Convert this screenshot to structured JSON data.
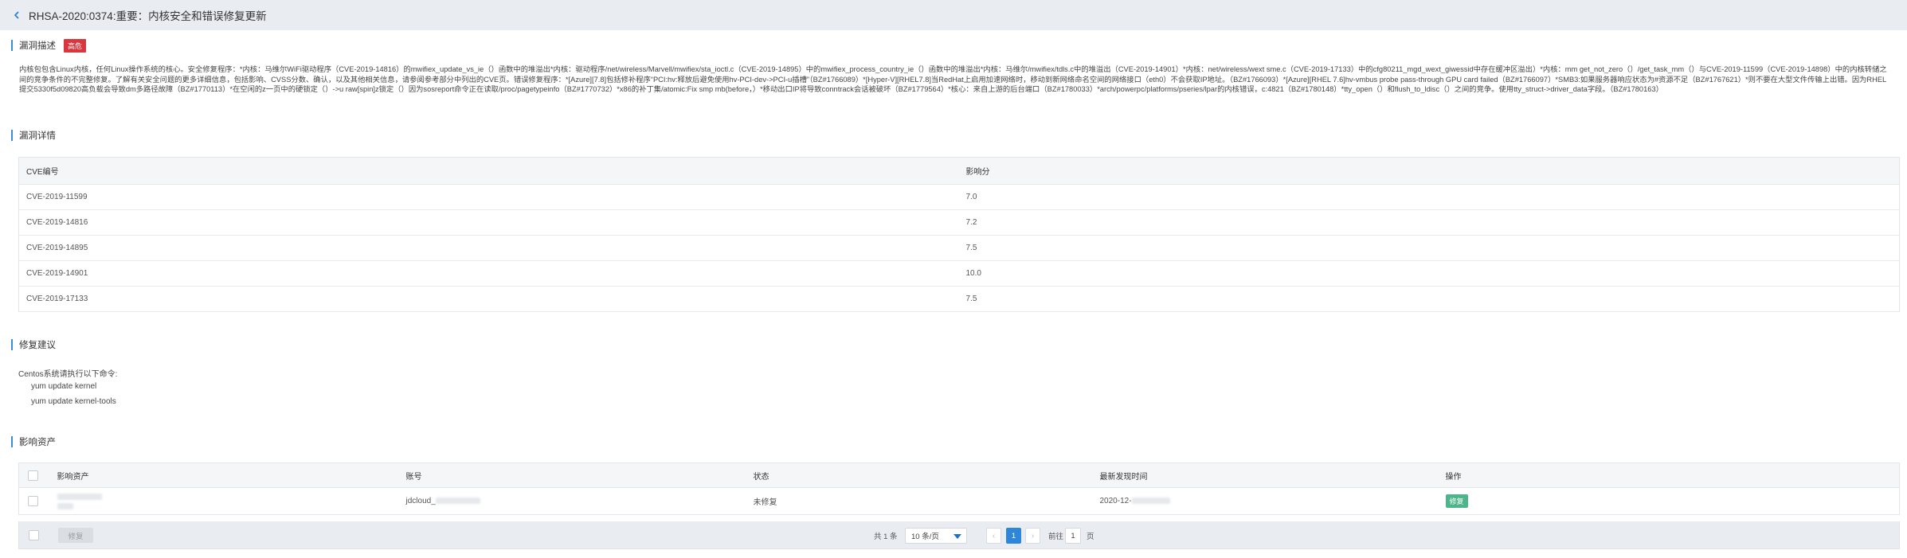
{
  "header": {
    "title": "RHSA-2020:0374:重要：内核安全和错误修复更新"
  },
  "description": {
    "section_title": "漏洞描述",
    "severity": "高危",
    "text": "内核包包含Linux内核，任何Linux操作系统的核心。安全修复程序：*内核：马维尔WiFi驱动程序（CVE-2019-14816）的mwifiex_update_vs_ie（）函数中的堆溢出*内核：驱动程序/net/wireless/Marvell/mwifiex/sta_ioctl.c（CVE-2019-14895）中的mwifiex_process_country_ie（）函数中的堆溢出*内核：马维尔/mwifiex/tdls.c中的堆溢出（CVE-2019-14901）*内核：net/wireless/wext sme.c（CVE-2019-17133）中的cfg80211_mgd_wext_giwessid中存在缓冲区溢出）*内核：mm get_not_zero（）/get_task_mm（）与CVE-2019-11599（CVE-2019-14898）中的内核转储之间的竞争条件的不完整修复。了解有关安全问题的更多详细信息，包括影响、CVSS分数、确认，以及其他相关信息，请参阅参考部分中列出的CVE页。错误修复程序：*[Azure][7.8]包括修补程序“PCI:hv:释放后避免使用hv-PCI-dev->PCI-u插槽”（BZ#1766089）*[Hyper-V][RHEL7.8]当RedHat上启用加速网络时，移动到新网络命名空间的网络接口（eth0）不会获取IP地址。（BZ#1766093）*[Azure][RHEL 7.6]hv-vmbus probe pass-through GPU card failed（BZ#1766097）*SMB3:如果服务器响应状态为#资源不足（BZ#1767621）*则不要在大型文件传输上出错。因为RHEL提交5330f5d09820高负载会导致dm多路径故障（BZ#1770113）*在空闲的z一页中的硬锁定（）->u raw[spin]z锁定（）因为sosreport命令正在读取/proc/pagetypeinfo（BZ#1770732）*x86的补丁集/atomic:Fix smp mb(before，）*移动出口IP将导致conntrack会话被破坏（BZ#1779564）*核心：来自上游的后台端口（BZ#1780033）*arch/powerpc/platforms/pseries/lpar的内核错误，c:4821（BZ#1780148）*tty_open（）和flush_to_ldisc（）之间的竞争。使用tty_struct->driver_data字段。（BZ#1780163）"
  },
  "details": {
    "section_title": "漏洞详情",
    "columns": [
      "CVE编号",
      "影响分"
    ],
    "rows": [
      [
        "CVE-2019-11599",
        "7.0"
      ],
      [
        "CVE-2019-14816",
        "7.2"
      ],
      [
        "CVE-2019-14895",
        "7.5"
      ],
      [
        "CVE-2019-14901",
        "10.0"
      ],
      [
        "CVE-2019-17133",
        "7.5"
      ]
    ]
  },
  "fix": {
    "section_title": "修复建议",
    "intro": "Centos系统请执行以下命令:",
    "commands": [
      "yum update kernel",
      "yum update kernel-tools"
    ]
  },
  "assets": {
    "section_title": "影响资产",
    "columns": [
      "影响资产",
      "账号",
      "状态",
      "最新发现时间",
      "操作"
    ],
    "rows": [
      {
        "account": "jdcloud_",
        "status": "未修复",
        "time": "2020-12-",
        "action": "修复"
      }
    ],
    "batch_fix": "修复",
    "pager": {
      "total": "共 1 条",
      "page_size": "10 条/页",
      "prev": "‹",
      "current": "1",
      "next": "›",
      "goto_label": "前往",
      "goto_value": "1",
      "page_suffix": "页"
    }
  },
  "colors": {
    "accent": "#3c8dd7",
    "danger": "#d9363e",
    "success": "#4cb58a",
    "pager_active": "#2d86d9"
  }
}
